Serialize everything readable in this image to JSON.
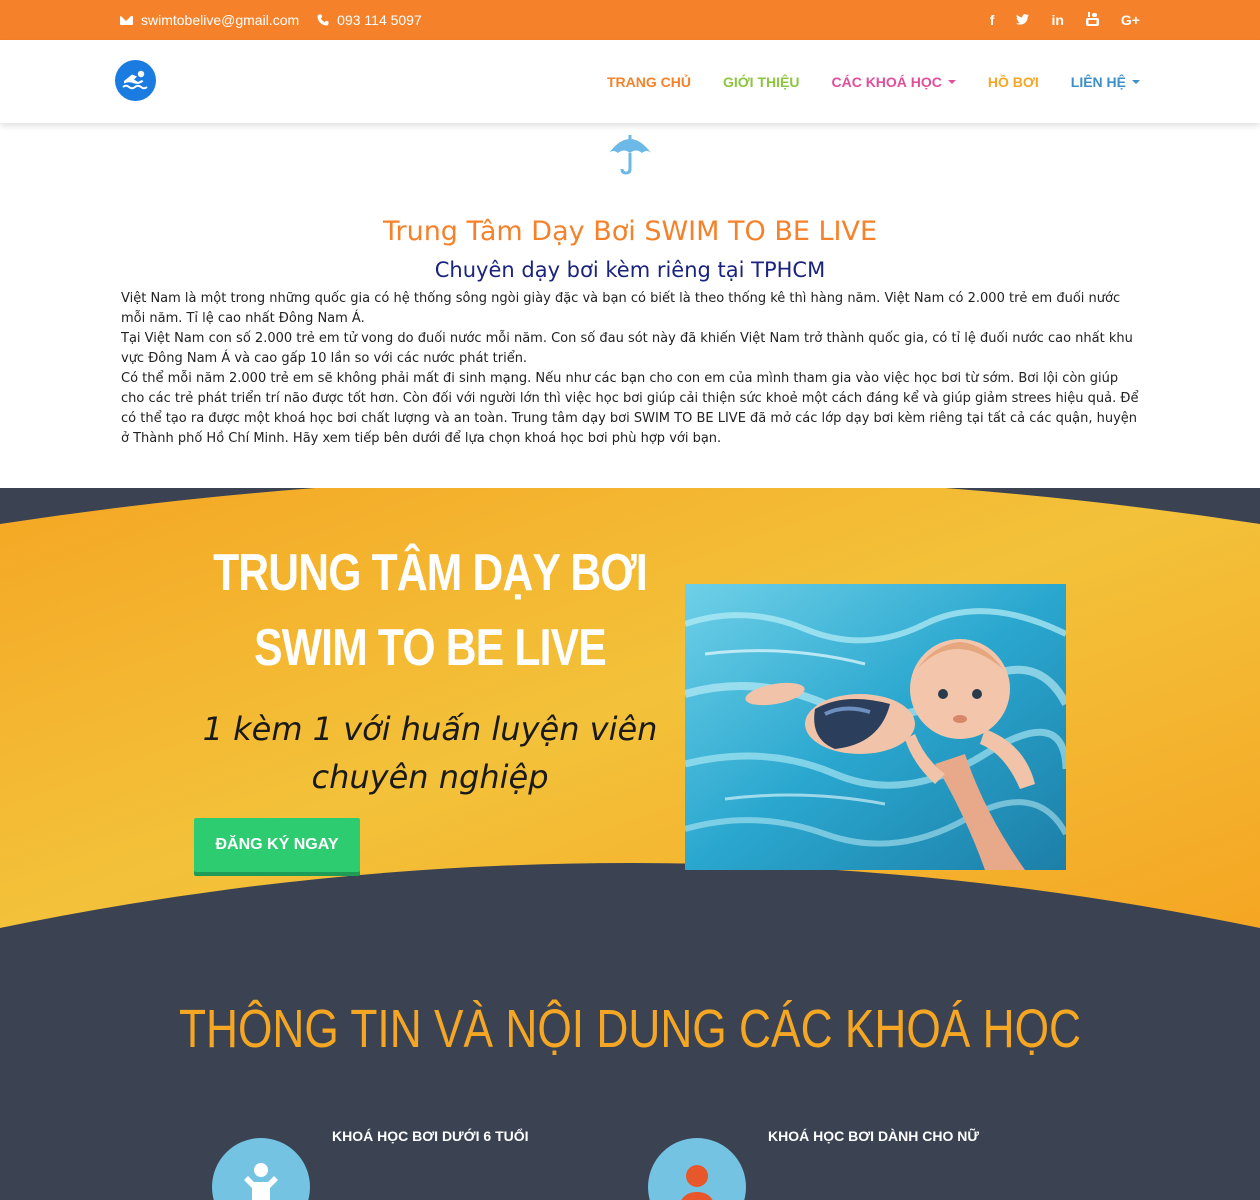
{
  "topbar": {
    "email": "swimtobelive@gmail.com",
    "phone": "093 114 5097",
    "social": [
      {
        "icon": "facebook-icon",
        "glyph": "f"
      },
      {
        "icon": "twitter-icon",
        "glyph": "🐦"
      },
      {
        "icon": "linkedin-icon",
        "glyph": "in"
      },
      {
        "icon": "youtube-icon",
        "glyph": "▶"
      },
      {
        "icon": "google-plus-icon",
        "glyph": "G+"
      }
    ]
  },
  "nav": {
    "items": [
      {
        "label": "TRANG CHỦ",
        "color": "#f5822a",
        "dropdown": false
      },
      {
        "label": "GIỚI THIỆU",
        "color": "#8cc63f",
        "dropdown": false
      },
      {
        "label": "CÁC KHOÁ HỌC",
        "color": "#e04f9a",
        "dropdown": true
      },
      {
        "label": "HỒ BƠI",
        "color": "#f5a623",
        "dropdown": false
      },
      {
        "label": "LIÊN HỆ",
        "color": "#3d8fc7",
        "dropdown": true
      }
    ]
  },
  "intro": {
    "title": "Trung Tâm Dạy Bơi SWIM TO BE LIVE",
    "subtitle": "Chuyên dạy bơi kèm riêng tại TPHCM",
    "paragraphs": [
      "Việt Nam là một trong những quốc gia có hệ thống sông ngòi giày đặc và bạn có biết là theo thống kê thì hàng năm. Việt Nam có 2.000 trẻ em đuối nước mỗi năm. Tỉ lệ cao nhất Đông Nam Á.",
      "Tại Việt Nam con số 2.000 trẻ em tử vong do đuối nước mỗi năm. Con số đau sót này đã khiến Việt Nam trở thành quốc gia, có tỉ lệ đuối nước cao nhất khu vực Đông Nam Á và cao gấp 10 lần so với các nước phát triển.",
      "Có thể mỗi năm 2.000 trẻ em sẽ không phải mất đi sinh mạng. Nếu như các bạn cho con em của mình tham gia vào việc học bơi từ sớm. Bơi lội còn giúp cho các trẻ phát triển trí não được tốt hơn. Còn đối với người lớn thì việc học bơi giúp cải thiện sức khoẻ một cách đáng kể và giúp giảm strees hiệu quả. Để có thể tạo ra được một khoá học bơi chất lượng và an toàn. Trung tâm dạy bơi SWIM TO BE LIVE đã mở các lớp dạy bơi kèm riêng tại tất cả các quận, huyện ở Thành phố Hồ Chí Minh. Hãy xem tiếp bên dưới để lựa chọn khoá học bơi phù hợp với bạn."
    ]
  },
  "hero": {
    "title_line1": "TRUNG TÂM DẠY BƠI",
    "title_line2": "SWIM TO BE LIVE",
    "script_line1": "1 kèm 1 với huấn luyện viên",
    "script_line2": "chuyên nghiệp",
    "cta_label": "ĐĂNG KÝ NGAY"
  },
  "courses": {
    "heading": "THÔNG TIN VÀ NỘI DUNG CÁC KHOÁ HỌC",
    "items": [
      {
        "title": "KHOÁ HỌC BƠI DƯỚI 6 TUỔI",
        "icon": "child-icon"
      },
      {
        "title": "KHOÁ HỌC BƠI DÀNH CHO NỮ",
        "icon": "woman-icon"
      }
    ]
  },
  "colors": {
    "topbar": "#f5822a",
    "hero_dark": "#3b4353",
    "hero_orange": "#f5a623",
    "cta_green": "#2ecc71"
  }
}
